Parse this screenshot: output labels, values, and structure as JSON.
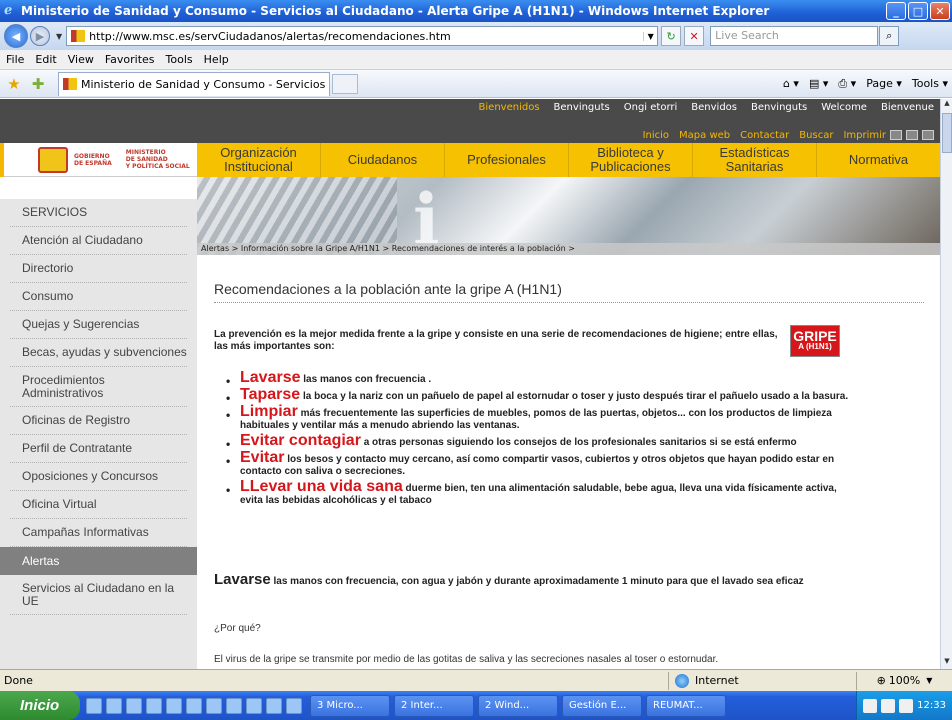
{
  "window": {
    "title": "Ministerio de Sanidad y Consumo - Servicios al Ciudadano - Alerta Gripe A (H1N1) - Windows Internet Explorer",
    "minimize": "_",
    "maximize": "□",
    "close": "✕"
  },
  "address": {
    "url": "http://www.msc.es/servCiudadanos/alertas/recomendaciones.htm",
    "search_placeholder": "Live Search"
  },
  "menu": [
    "File",
    "Edit",
    "View",
    "Favorites",
    "Tools",
    "Help"
  ],
  "tab": {
    "label": "Ministerio de Sanidad y Consumo - Servicios al Ciudad..."
  },
  "commands": {
    "page": "Page ▾",
    "tools": "Tools ▾"
  },
  "site": {
    "languages": [
      "Bienvenidos",
      "Benvinguts",
      "Ongi etorri",
      "Benvidos",
      "Benvinguts",
      "Welcome",
      "Bienvenue"
    ],
    "util_links": [
      "Inicio",
      "Mapa web",
      "Contactar",
      "Buscar",
      "Imprimir"
    ],
    "logo": {
      "gob": "GOBIERNO\nDE ESPAÑA",
      "min": "MINISTERIO\nDE SANIDAD\nY POLÍTICA SOCIAL"
    },
    "nav": [
      "Organización Institucional",
      "Ciudadanos",
      "Profesionales",
      "Biblioteca y Publicaciones",
      "Estadísticas Sanitarias",
      "Normativa"
    ],
    "breadcrumb": "Alertas >   Información sobre la Gripe A/H1N1 >   Recomendaciones de interés a la población >",
    "sidebar": [
      "SERVICIOS",
      "Atención al Ciudadano",
      "Directorio",
      "Consumo",
      "Quejas y Sugerencias",
      "Becas, ayudas y subvenciones",
      "Procedimientos Administrativos",
      "Oficinas de Registro",
      "Perfil de Contratante",
      "Oposiciones y Concursos",
      "Oficina Virtual",
      "Campañas Informativas",
      "Alertas",
      "Servicios al Ciudadano en la UE"
    ]
  },
  "content": {
    "title": "Recomendaciones a la población ante la gripe A (H1N1)",
    "intro": "La prevención es la mejor medida frente a la gripe y consiste en una serie de recomendaciones de higiene; entre ellas, las más importantes son:",
    "badge": {
      "line1": "GRIPE",
      "line2": "A (H1N1)"
    },
    "recommendations": [
      {
        "kw": "Lavarse",
        "text": "  las manos con frecuencia ."
      },
      {
        "kw": "Taparse",
        "text": " la boca y la nariz con un pañuelo de papel al estornudar o toser y justo después tirar el pañuelo usado a la basura."
      },
      {
        "kw": "Limpiar",
        "text": " más frecuentemente las superficies de muebles, pomos de las puertas, objetos... con los productos de limpieza habituales y ventilar más a menudo abriendo las ventanas."
      },
      {
        "kw": "Evitar contagiar",
        "text": " a otras personas siguiendo los consejos de los profesionales sanitarios si se está enfermo"
      },
      {
        "kw": "Evitar",
        "text": " los besos y contacto muy cercano, así como compartir vasos, cubiertos y otros objetos que hayan podido estar en contacto con saliva o secreciones."
      },
      {
        "kw": "LLevar una vida sana",
        "text": " duerme bien, ten una alimentación saludable, bebe agua, lleva una vida físicamente activa, evita las bebidas alcohólicas  y el tabaco"
      }
    ],
    "lavarse_kw": "Lavarse",
    "lavarse_text": " las manos con frecuencia, con agua y jabón y durante aproximadamente 1 minuto para que el lavado sea eficaz",
    "porque": "¿Por qué?",
    "virus": "El virus de la gripe se transmite por medio de las gotitas de saliva y las secreciones nasales al toser o estornudar."
  },
  "status": {
    "text": "Done",
    "zone": "Internet",
    "zoom": "100%"
  },
  "taskbar": {
    "start": "Inicio",
    "tasks": [
      "3 Micro...",
      "2 Inter...",
      "2 Wind...",
      "Gestión E...",
      "REUMAT..."
    ],
    "clock": "12:33"
  }
}
